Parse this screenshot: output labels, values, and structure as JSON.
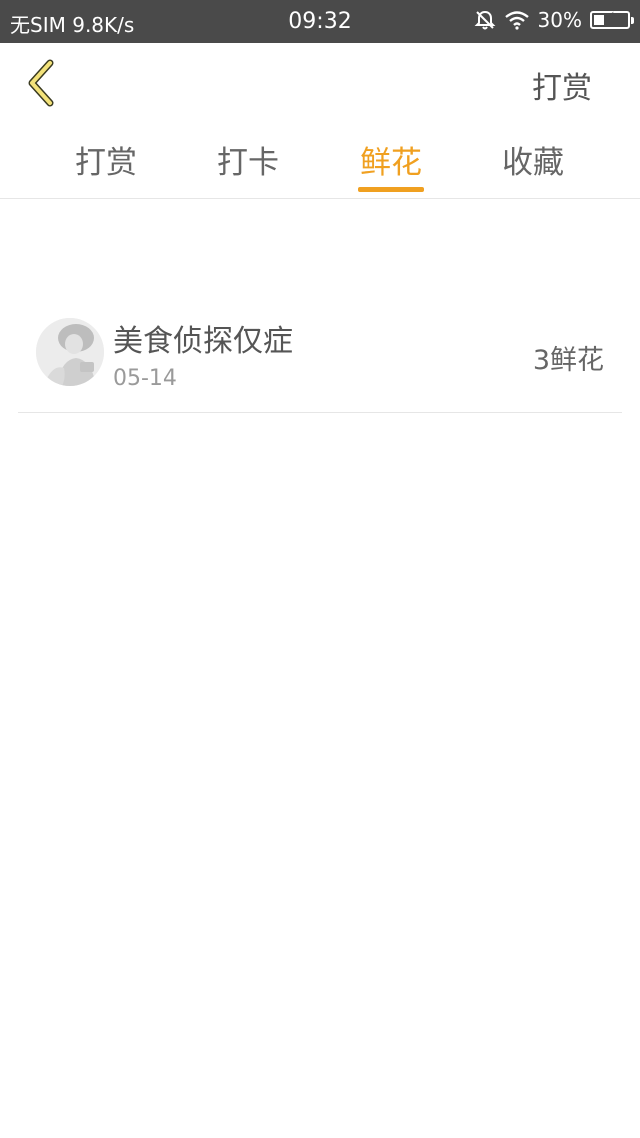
{
  "status_bar": {
    "carrier": "无SIM",
    "network_speed": "9.8K/s",
    "time": "09:32",
    "battery_percent_label": "30%",
    "battery_level": 0.3,
    "icons": [
      "mute-icon",
      "wifi-icon",
      "battery-icon"
    ]
  },
  "header": {
    "back_icon": "chevron-left-icon",
    "action_label": "打赏",
    "accent_color": "#f0a020"
  },
  "tabs": [
    {
      "label": "打赏",
      "active": false
    },
    {
      "label": "打卡",
      "active": false
    },
    {
      "label": "鲜花",
      "active": true
    },
    {
      "label": "收藏",
      "active": false
    }
  ],
  "list": {
    "items": [
      {
        "name": "美食侦探仅症",
        "date": "05-14",
        "count": "3鲜花"
      }
    ]
  }
}
